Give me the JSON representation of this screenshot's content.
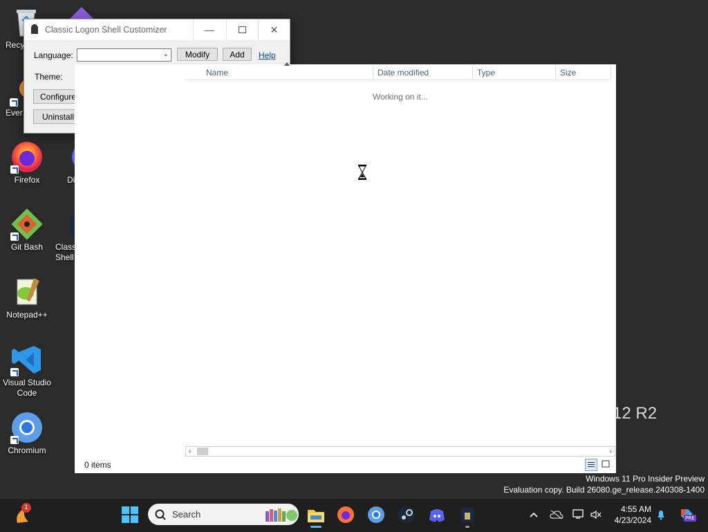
{
  "desktop": {
    "icons": [
      {
        "label": "Recy",
        "name": "recycle-bin-icon"
      },
      {
        "label": "Ever",
        "name": "everything-icon"
      },
      {
        "label": "Firefox",
        "name": "firefox-icon"
      },
      {
        "label": "Di",
        "name": "discord-desktop-icon"
      },
      {
        "label": "Git Bash",
        "name": "git-bash-icon"
      },
      {
        "label": "Class\nShell",
        "name": "classic-shell-icon"
      },
      {
        "label": "Notepad++",
        "name": "notepadpp-icon"
      },
      {
        "label": "Visual Studio\nCode",
        "name": "vscode-icon"
      },
      {
        "label": "Chromium",
        "name": "chromium-icon"
      }
    ],
    "watermark_line1": "Windows 11 Pro Insider Preview",
    "watermark_line2": "Evaluation copy. Build 26080.ge_release.240308-1400",
    "background_logo_text": "12 R2"
  },
  "customizer": {
    "title": "Classic Logon Shell Customizer",
    "language_label": "Language:",
    "language_value": "",
    "modify_label": "Modify",
    "add_label": "Add",
    "help_label": "Help",
    "theme_label": "Theme:",
    "configure_label": "Configure",
    "uninstall_label": "Uninstall"
  },
  "browser": {
    "columns": [
      "Name",
      "Date modified",
      "Type",
      "Size"
    ],
    "status_message": "Working on it...",
    "items_count": "0 items"
  },
  "taskbar": {
    "search_label": "Search",
    "notification_badge": "1",
    "time": "4:55 AM",
    "date": "4/23/2024",
    "copilot_badge": "PRE"
  },
  "colors": {
    "desktop_bg": "#2b2b2b",
    "taskbar_bg": "#1f1f1f",
    "link": "#0645ad",
    "header_text": "#4c607a"
  }
}
